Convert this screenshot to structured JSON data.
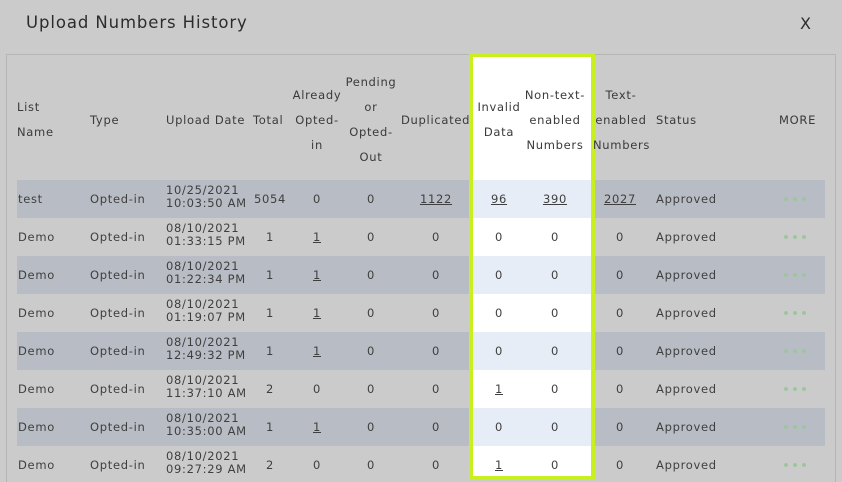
{
  "modal": {
    "title": "Upload Numbers History",
    "close_label": "X"
  },
  "table": {
    "headers": {
      "list_name": [
        "List",
        "Name"
      ],
      "type": "Type",
      "upload_date": "Upload Date",
      "total": "Total",
      "already_opted_in": [
        "Already",
        "Opted-",
        "in"
      ],
      "pending": [
        "Pending",
        "or",
        "Opted-",
        "Out"
      ],
      "duplicated": "Duplicated",
      "invalid_data": [
        "Invalid",
        "Data"
      ],
      "non_text_enabled": [
        "Non-text-",
        "enabled",
        "Numbers"
      ],
      "text_enabled": [
        "Text-",
        "enabled",
        "Numbers"
      ],
      "status": "Status",
      "more": "MORE"
    },
    "rows": [
      {
        "name": "test",
        "type": "Opted-in",
        "date": "10/25/2021",
        "time": "10:03:50 AM",
        "total": "5054",
        "already": "0",
        "pending": "0",
        "duplicated": "1122",
        "invalid": "96",
        "non_text": "390",
        "text_enabled": "2027",
        "status": "Approved"
      },
      {
        "name": "Demo",
        "type": "Opted-in",
        "date": "08/10/2021",
        "time": "01:33:15 PM",
        "total": "1",
        "already": "1",
        "pending": "0",
        "duplicated": "0",
        "invalid": "0",
        "non_text": "0",
        "text_enabled": "0",
        "status": "Approved"
      },
      {
        "name": "Demo",
        "type": "Opted-in",
        "date": "08/10/2021",
        "time": "01:22:34 PM",
        "total": "1",
        "already": "1",
        "pending": "0",
        "duplicated": "0",
        "invalid": "0",
        "non_text": "0",
        "text_enabled": "0",
        "status": "Approved"
      },
      {
        "name": "Demo",
        "type": "Opted-in",
        "date": "08/10/2021",
        "time": "01:19:07 PM",
        "total": "1",
        "already": "1",
        "pending": "0",
        "duplicated": "0",
        "invalid": "0",
        "non_text": "0",
        "text_enabled": "0",
        "status": "Approved"
      },
      {
        "name": "Demo",
        "type": "Opted-in",
        "date": "08/10/2021",
        "time": "12:49:32 PM",
        "total": "1",
        "already": "1",
        "pending": "0",
        "duplicated": "0",
        "invalid": "0",
        "non_text": "0",
        "text_enabled": "0",
        "status": "Approved"
      },
      {
        "name": "Demo",
        "type": "Opted-in",
        "date": "08/10/2021",
        "time": "11:37:10 AM",
        "total": "2",
        "already": "0",
        "pending": "0",
        "duplicated": "0",
        "invalid": "1",
        "non_text": "0",
        "text_enabled": "0",
        "status": "Approved"
      },
      {
        "name": "Demo",
        "type": "Opted-in",
        "date": "08/10/2021",
        "time": "10:35:00 AM",
        "total": "1",
        "already": "1",
        "pending": "0",
        "duplicated": "0",
        "invalid": "0",
        "non_text": "0",
        "text_enabled": "0",
        "status": "Approved"
      },
      {
        "name": "Demo",
        "type": "Opted-in",
        "date": "08/10/2021",
        "time": "09:27:29 AM",
        "total": "2",
        "already": "0",
        "pending": "0",
        "duplicated": "0",
        "invalid": "1",
        "non_text": "0",
        "text_enabled": "0",
        "status": "Approved"
      }
    ]
  },
  "more_icon": "three-dots-icon",
  "colors": {
    "overlay": "#cbcbcb",
    "row_band": "#b8bcc4",
    "highlight_border": "#c9f01e",
    "highlight_band": "#e7edf7",
    "dots": "#9fc59f"
  }
}
